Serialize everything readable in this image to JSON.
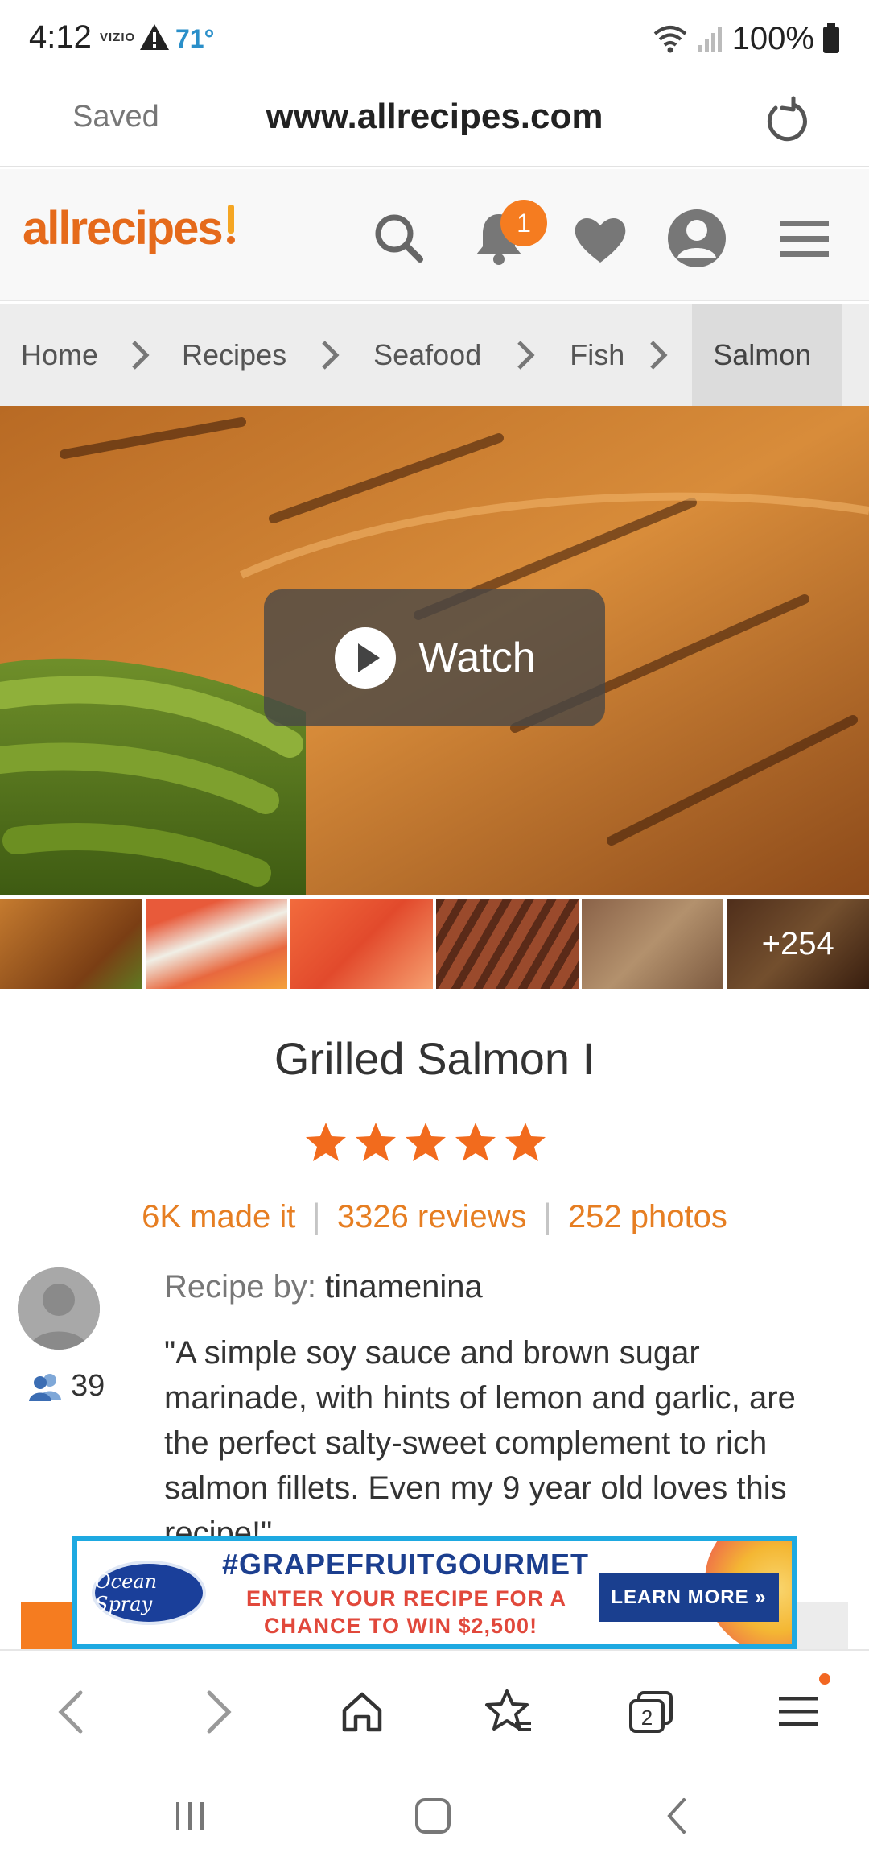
{
  "status_bar": {
    "time": "4:12",
    "carrier": "VIZIO",
    "temperature": "71°",
    "battery": "100%"
  },
  "browser": {
    "saved_label": "Saved",
    "url": "www.allrecipes.com",
    "tab_count": "2"
  },
  "site": {
    "logo": "allrecipes",
    "notification_count": "1"
  },
  "breadcrumb": [
    "Home",
    "Recipes",
    "Seafood",
    "Fish",
    "Salmon"
  ],
  "hero": {
    "watch_label": "Watch",
    "more_photos": "+254"
  },
  "recipe": {
    "title": "Grilled Salmon I",
    "rating": 5,
    "made_it": "6K made it",
    "reviews": "3326 reviews",
    "photos": "252 photos",
    "by_label": "Recipe by:",
    "author": "tinamenina",
    "followers": "39",
    "description": "\"A simple soy sauce and brown sugar marinade, with hints of lemon and garlic, are the perfect salty-sweet complement to rich salmon fillets. Even my 9 year old loves this recipe!\""
  },
  "ad": {
    "brand": "Ocean Spray",
    "hashtag": "#GRAPEFRUITGOURMET",
    "line1": "ENTER YOUR RECIPE FOR A",
    "line2": "CHANCE TO WIN $2,500!",
    "cta": "LEARN MORE »"
  },
  "colors": {
    "brand_orange": "#e56a1b",
    "badge_orange": "#f57c20",
    "ad_blue": "#1ea9e1",
    "temp_blue": "#2a8fc9"
  }
}
